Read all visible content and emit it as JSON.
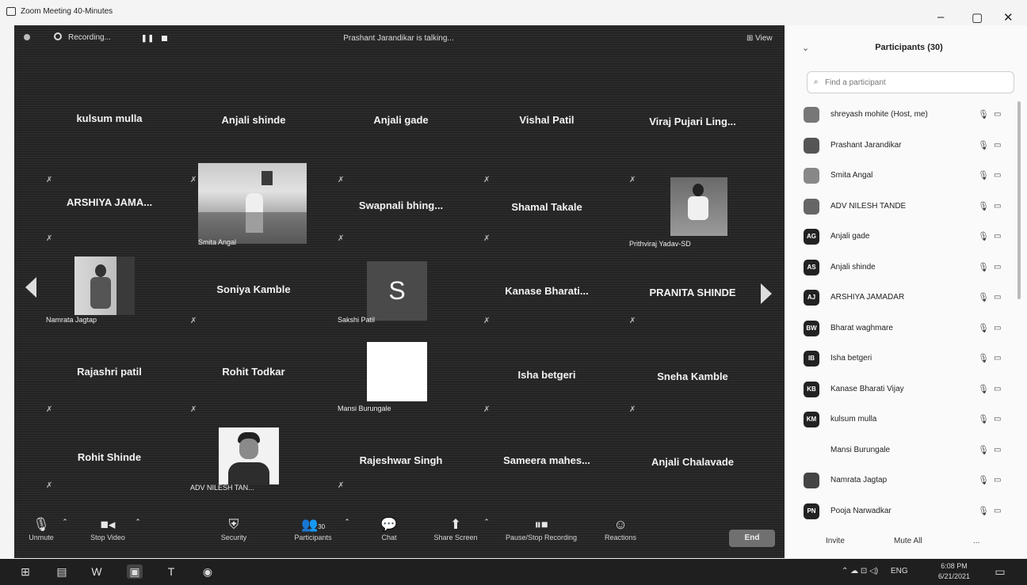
{
  "window": {
    "title": "Zoom Meeting 40-Minutes",
    "minimize": "–",
    "maximize": "▢",
    "close": "✕"
  },
  "topbar": {
    "recording": "Recording...",
    "talking": "Prashant Jarandikar is talking...",
    "view": "⊞ View"
  },
  "tiles": [
    {
      "name": "kulsum mulla",
      "label": ""
    },
    {
      "name": "Anjali shinde",
      "label": ""
    },
    {
      "name": "Anjali gade",
      "label": ""
    },
    {
      "name": "Vishal Patil",
      "label": ""
    },
    {
      "name": "Viraj Pujari Ling...",
      "label": ""
    },
    {
      "name": "ARSHIYA JAMA...",
      "label": ""
    },
    {
      "name": "",
      "label": "Smita Angal"
    },
    {
      "name": "Swapnali bhing...",
      "label": ""
    },
    {
      "name": "Shamal Takale",
      "label": ""
    },
    {
      "name": "",
      "label": "Prithviraj Yadav-SD"
    },
    {
      "name": "",
      "label": "Namrata Jagtap"
    },
    {
      "name": "Soniya Kamble",
      "label": ""
    },
    {
      "name": "",
      "label": "Sakshi Patil",
      "avatar": "S"
    },
    {
      "name": "Kanase Bharati...",
      "label": ""
    },
    {
      "name": "PRANITA SHINDE",
      "label": ""
    },
    {
      "name": "Rajashri patil",
      "label": ""
    },
    {
      "name": "Rohit Todkar",
      "label": ""
    },
    {
      "name": "",
      "label": "Mansi Burungale"
    },
    {
      "name": "Isha betgeri",
      "label": ""
    },
    {
      "name": "Sneha Kamble",
      "label": ""
    },
    {
      "name": "Rohit Shinde",
      "label": ""
    },
    {
      "name": "",
      "label": "ADV NILESH TAN..."
    },
    {
      "name": "Rajeshwar Singh",
      "label": ""
    },
    {
      "name": "Sameera mahes...",
      "label": ""
    },
    {
      "name": "Anjali Chalavade",
      "label": ""
    }
  ],
  "toolbar": {
    "unmute": "Unmute",
    "stop_video": "Stop Video",
    "security": "Security",
    "participants": "Participants",
    "participants_count": "30",
    "chat": "Chat",
    "share_screen": "Share Screen",
    "pause_recording": "Pause/Stop Recording",
    "reactions": "Reactions",
    "end": "End"
  },
  "panel": {
    "title": "Participants (30)",
    "search_placeholder": "Find a participant",
    "participants": [
      {
        "initials": "",
        "name": "shreyash mohite (Host, me)"
      },
      {
        "initials": "",
        "name": "Prashant Jarandikar"
      },
      {
        "initials": "",
        "name": "Smita Angal"
      },
      {
        "initials": "",
        "name": "ADV NILESH TANDE"
      },
      {
        "initials": "AG",
        "name": "Anjali gade"
      },
      {
        "initials": "AS",
        "name": "Anjali shinde"
      },
      {
        "initials": "AJ",
        "name": "ARSHIYA JAMADAR"
      },
      {
        "initials": "BW",
        "name": "Bharat waghmare"
      },
      {
        "initials": "IB",
        "name": "Isha betgeri"
      },
      {
        "initials": "KB",
        "name": "Kanase Bharati Vijay"
      },
      {
        "initials": "KM",
        "name": "kulsum mulla"
      },
      {
        "initials": "",
        "name": "Mansi Burungale"
      },
      {
        "initials": "",
        "name": "Namrata Jagtap"
      },
      {
        "initials": "PN",
        "name": "Pooja Narwadkar"
      }
    ],
    "invite": "Invite",
    "mute_all": "Mute All",
    "more": "..."
  },
  "taskbar": {
    "lang": "ENG",
    "time": "6:08 PM",
    "date": "6/21/2021"
  }
}
